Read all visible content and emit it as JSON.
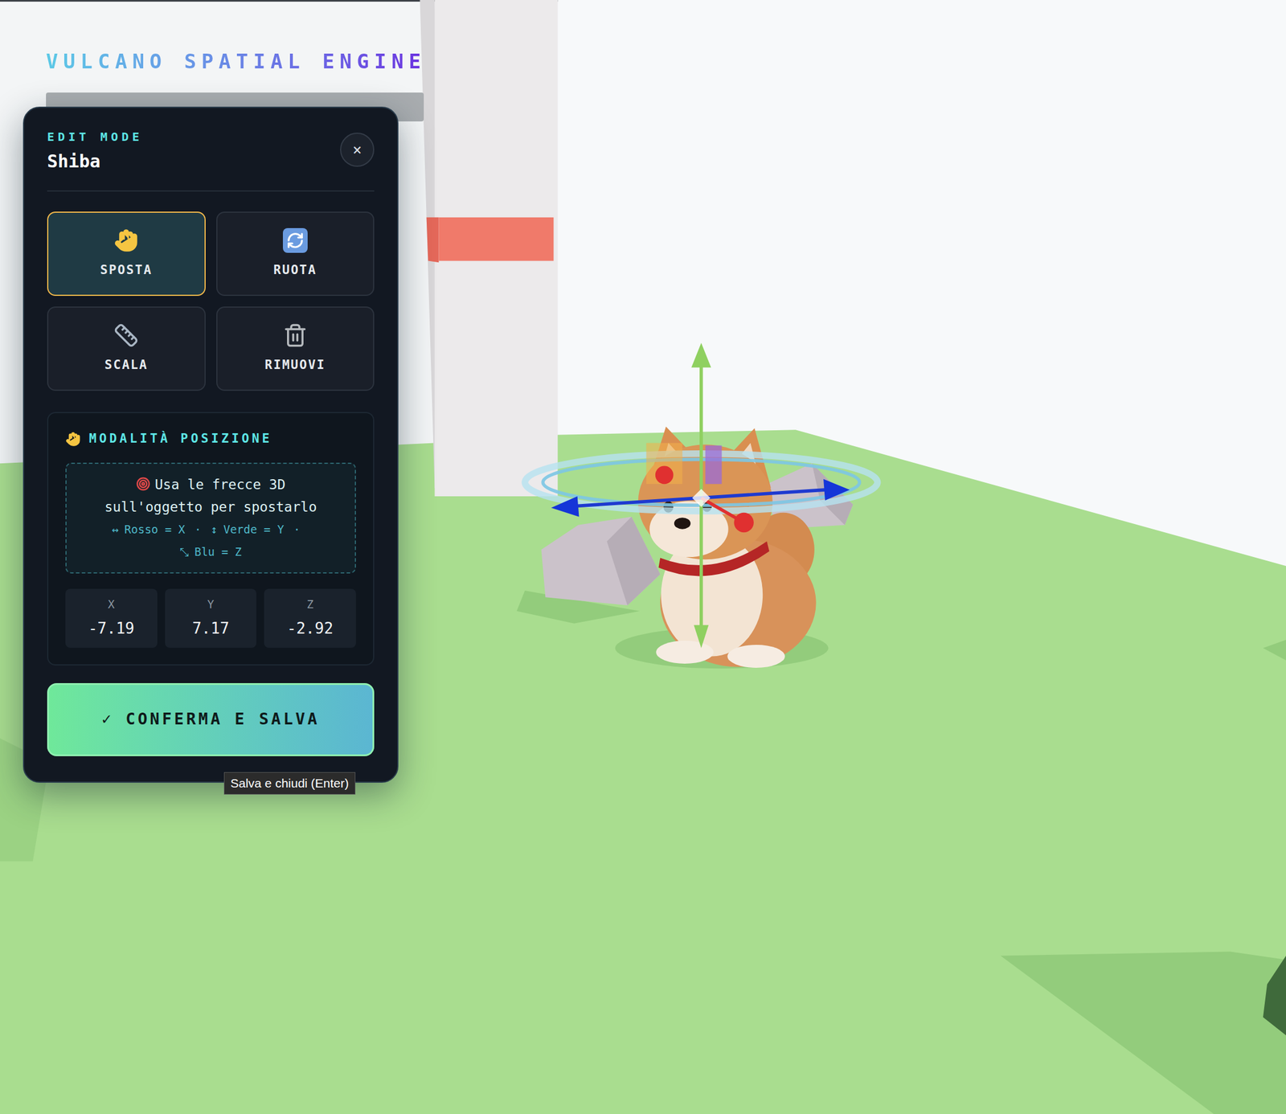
{
  "app": {
    "title": "VULCANO SPATIAL ENGINE"
  },
  "panel": {
    "mode": "EDIT MODE",
    "object": "Shiba",
    "close": "×",
    "tools": [
      {
        "label": "SPOSTA",
        "kind": "move",
        "selected": true
      },
      {
        "label": "RUOTA",
        "kind": "rotate",
        "selected": false
      },
      {
        "label": "SCALA",
        "kind": "scale",
        "selected": false
      },
      {
        "label": "RIMUOVI",
        "kind": "remove",
        "selected": false
      }
    ],
    "section": {
      "title": "MODALITÀ POSIZIONE",
      "hint": "Usa le frecce 3D sull'oggetto per spostarlo",
      "separator": "·",
      "legend": [
        {
          "glyph": "↔",
          "label": "Rosso = X"
        },
        {
          "glyph": "↕",
          "label": "Verde = Y"
        },
        {
          "glyph": "⤡",
          "label": "Blu = Z"
        }
      ],
      "coords": [
        {
          "axis": "X",
          "value": "-7.19"
        },
        {
          "axis": "Y",
          "value": "7.17"
        },
        {
          "axis": "Z",
          "value": "-2.92"
        }
      ]
    },
    "confirm": {
      "check": "✓",
      "label": "CONFERMA E SALVA",
      "tooltip": "Salva e chiudi (Enter)"
    }
  }
}
